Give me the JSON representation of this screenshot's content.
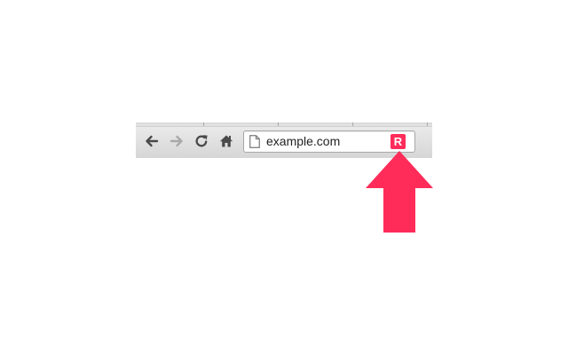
{
  "browser": {
    "toolbar": {
      "back_icon": "arrow-left-icon",
      "forward_icon": "arrow-right-icon",
      "reload_icon": "reload-icon",
      "home_icon": "home-icon"
    },
    "omnibox": {
      "url": "example.com",
      "page_icon": "page-icon"
    },
    "extension": {
      "letter": "R",
      "color": "#ff2c5a"
    }
  },
  "annotation": {
    "arrow_icon": "arrow-up-icon",
    "arrow_color": "#ff2c5a"
  }
}
